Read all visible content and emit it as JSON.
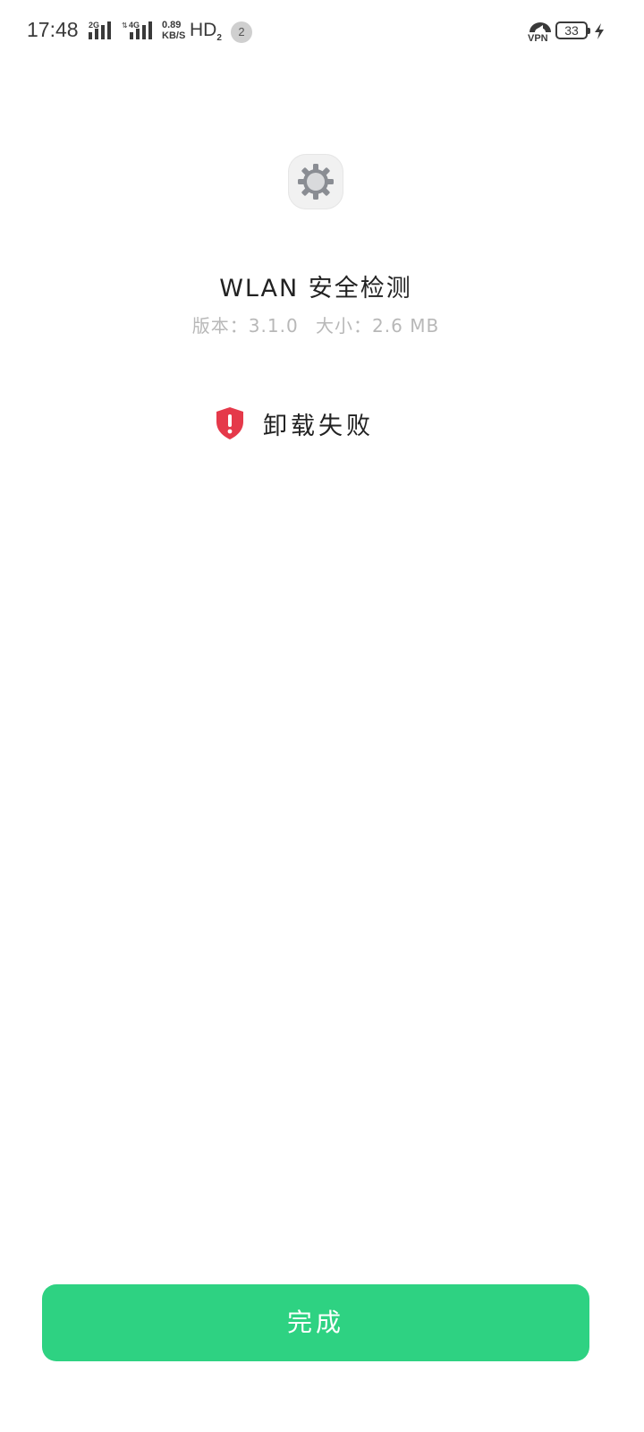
{
  "status_bar": {
    "time": "17:48",
    "network_2g": "2G",
    "network_4g": "4G",
    "net_speed_value": "0.89",
    "net_speed_unit": "KB/S",
    "hd_label": "HD",
    "hd_sub": "2",
    "notification_count": "2",
    "vpn_label": "VPN",
    "battery_level": "33"
  },
  "app": {
    "icon": "settings-gear-icon",
    "name": "WLAN 安全检测",
    "version_text": "版本：3.1.0",
    "size_text": "大小：2.6 MB"
  },
  "result": {
    "icon": "shield-alert-icon",
    "status_color": "#e5394a",
    "text": "卸载失败"
  },
  "actions": {
    "done_label": "完成",
    "done_color": "#2ed282"
  }
}
